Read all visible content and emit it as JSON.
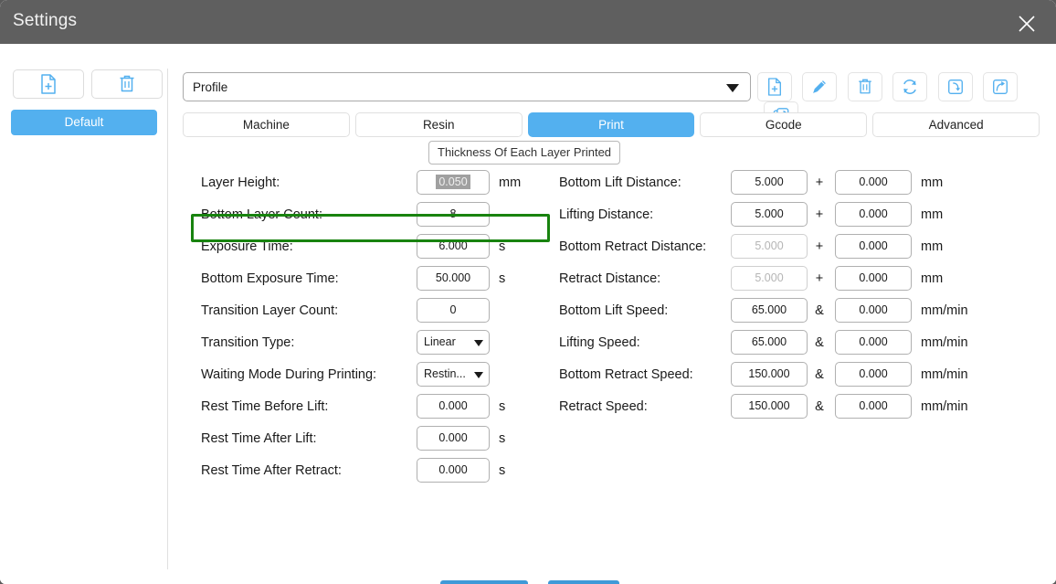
{
  "window": {
    "title": "Settings",
    "close_icon": "close-icon",
    "titlebar_color": "#5f5f5f",
    "accent_color": "#53b0ef",
    "highlight_color": "#18830f"
  },
  "sidebar": {
    "buttons": [
      {
        "name": "new-profile-button",
        "icon": "file-plus-icon"
      },
      {
        "name": "delete-profile-button",
        "icon": "trash-icon"
      }
    ],
    "profiles": [
      {
        "label": "Default",
        "selected": true
      }
    ]
  },
  "profile_select": {
    "value": "Profile",
    "arrow_icon": "chevron-down-icon"
  },
  "toolbar": {
    "buttons": [
      {
        "name": "new-button",
        "icon": "file-plus-icon"
      },
      {
        "name": "edit-button",
        "icon": "pencil-icon"
      },
      {
        "name": "delete-button",
        "icon": "trash-icon"
      },
      {
        "name": "refresh-button",
        "icon": "refresh-icon"
      },
      {
        "name": "import-button",
        "icon": "import-arrow-icon"
      },
      {
        "name": "export-button",
        "icon": "export-arrow-icon"
      },
      {
        "name": "export-all-button",
        "icon": "export-all-icon"
      }
    ]
  },
  "tabs": [
    {
      "label": "Machine",
      "active": false
    },
    {
      "label": "Resin",
      "active": false
    },
    {
      "label": "Print",
      "active": true
    },
    {
      "label": "Gcode",
      "active": false
    },
    {
      "label": "Advanced",
      "active": false
    }
  ],
  "tooltip": {
    "text": "Thickness Of Each Layer Printed"
  },
  "form": {
    "left_column": [
      {
        "label": "Layer Height:",
        "type": "input",
        "value": "0.050",
        "unit": "mm",
        "selected": true,
        "disabled": false,
        "highlighted": true
      },
      {
        "label": "Bottom Layer Count:",
        "type": "input",
        "value": "8",
        "unit": "",
        "selected": false,
        "disabled": false,
        "highlighted": false
      },
      {
        "label": "Exposure Time:",
        "type": "input",
        "value": "6.000",
        "unit": "s",
        "selected": false,
        "disabled": false,
        "highlighted": false
      },
      {
        "label": "Bottom Exposure Time:",
        "type": "input",
        "value": "50.000",
        "unit": "s",
        "selected": false,
        "disabled": false,
        "highlighted": false
      },
      {
        "label": "Transition Layer Count:",
        "type": "input",
        "value": "0",
        "unit": "",
        "selected": false,
        "disabled": false,
        "highlighted": false
      },
      {
        "label": "Transition Type:",
        "type": "select",
        "value": "Linear",
        "unit": "",
        "selected": false,
        "disabled": false,
        "highlighted": false
      },
      {
        "label": "Waiting Mode During Printing:",
        "type": "select",
        "value": "Restin...",
        "unit": "",
        "selected": false,
        "disabled": false,
        "highlighted": false
      },
      {
        "label": "Rest Time Before Lift:",
        "type": "input",
        "value": "0.000",
        "unit": "s",
        "selected": false,
        "disabled": false,
        "highlighted": false
      },
      {
        "label": "Rest Time After Lift:",
        "type": "input",
        "value": "0.000",
        "unit": "s",
        "selected": false,
        "disabled": false,
        "highlighted": false
      },
      {
        "label": "Rest Time After Retract:",
        "type": "input",
        "value": "0.000",
        "unit": "s",
        "selected": false,
        "disabled": false,
        "highlighted": false
      }
    ],
    "right_column": [
      {
        "label": "Bottom Lift Distance:",
        "value1": "5.000",
        "op": "+",
        "value2": "0.000",
        "unit": "mm",
        "disabled1": false
      },
      {
        "label": "Lifting Distance:",
        "value1": "5.000",
        "op": "+",
        "value2": "0.000",
        "unit": "mm",
        "disabled1": false
      },
      {
        "label": "Bottom Retract Distance:",
        "value1": "5.000",
        "op": "+",
        "value2": "0.000",
        "unit": "mm",
        "disabled1": true
      },
      {
        "label": "Retract Distance:",
        "value1": "5.000",
        "op": "+",
        "value2": "0.000",
        "unit": "mm",
        "disabled1": true
      },
      {
        "label": "Bottom Lift Speed:",
        "value1": "65.000",
        "op": "&",
        "value2": "0.000",
        "unit": "mm/min",
        "disabled1": false
      },
      {
        "label": "Lifting Speed:",
        "value1": "65.000",
        "op": "&",
        "value2": "0.000",
        "unit": "mm/min",
        "disabled1": false
      },
      {
        "label": "Bottom Retract Speed:",
        "value1": "150.000",
        "op": "&",
        "value2": "0.000",
        "unit": "mm/min",
        "disabled1": false
      },
      {
        "label": "Retract Speed:",
        "value1": "150.000",
        "op": "&",
        "value2": "0.000",
        "unit": "mm/min",
        "disabled1": false
      }
    ]
  }
}
